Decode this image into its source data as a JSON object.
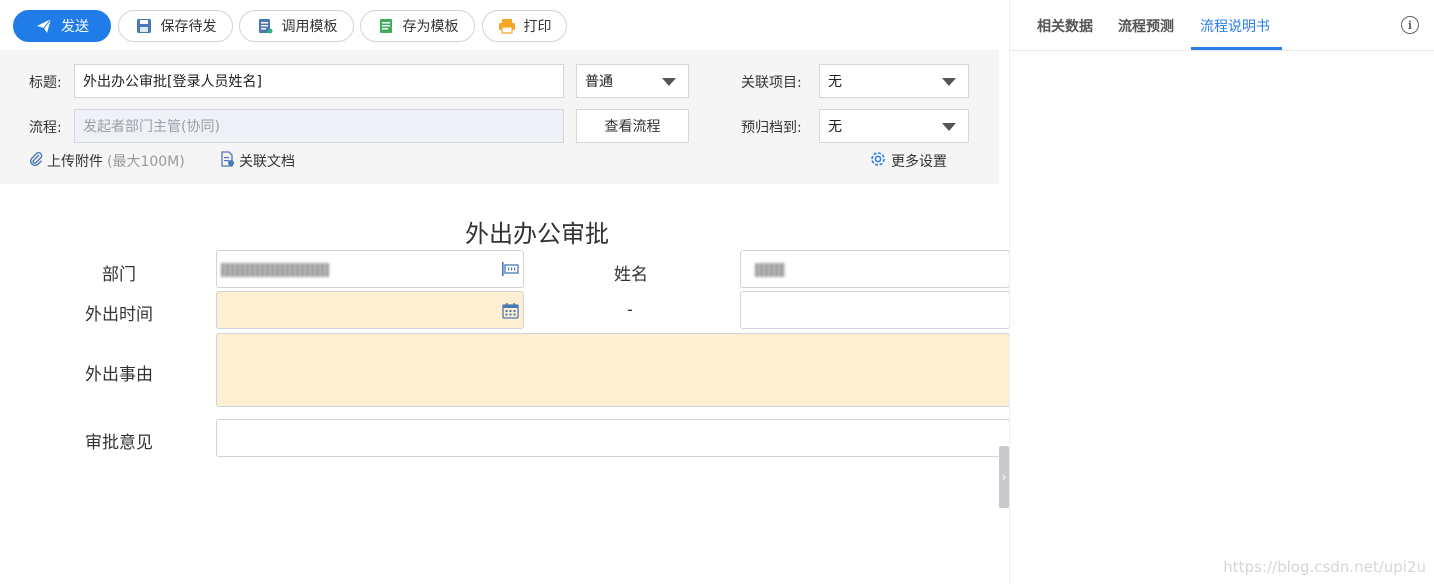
{
  "toolbar": {
    "send_label": "发送",
    "save_draft_label": "保存待发",
    "use_template_label": "调用模板",
    "save_template_label": "存为模板",
    "print_label": "打印"
  },
  "header": {
    "title_label": "标题:",
    "title_value": "外出办公审批[登录人员姓名]",
    "priority_value": "普通",
    "related_project_label": "关联项目:",
    "related_project_value": "无",
    "flow_label": "流程:",
    "flow_placeholder": "发起者部门主管(协同)",
    "view_flow_label": "查看流程",
    "archive_label": "预归档到:",
    "archive_value": "无",
    "upload_label": "上传附件",
    "upload_limit": "(最大100M)",
    "related_doc_label": "关联文档",
    "more_settings_label": "更多设置"
  },
  "form": {
    "title": "外出办公审批",
    "department_label": "部门",
    "name_label": "姓名",
    "out_time_label": "外出时间",
    "time_separator": "-",
    "reason_label": "外出事由",
    "approval_label": "审批意见"
  },
  "right_panel": {
    "tabs": [
      "相关数据",
      "流程预测",
      "流程说明书"
    ],
    "active_tab": "流程说明书",
    "info_icon": "i"
  },
  "watermark": "https://blog.csdn.net/upi2u",
  "colors": {
    "primary": "#1f7ce8",
    "active_tab": "#2b7de9",
    "required_field": "#feefd3"
  }
}
